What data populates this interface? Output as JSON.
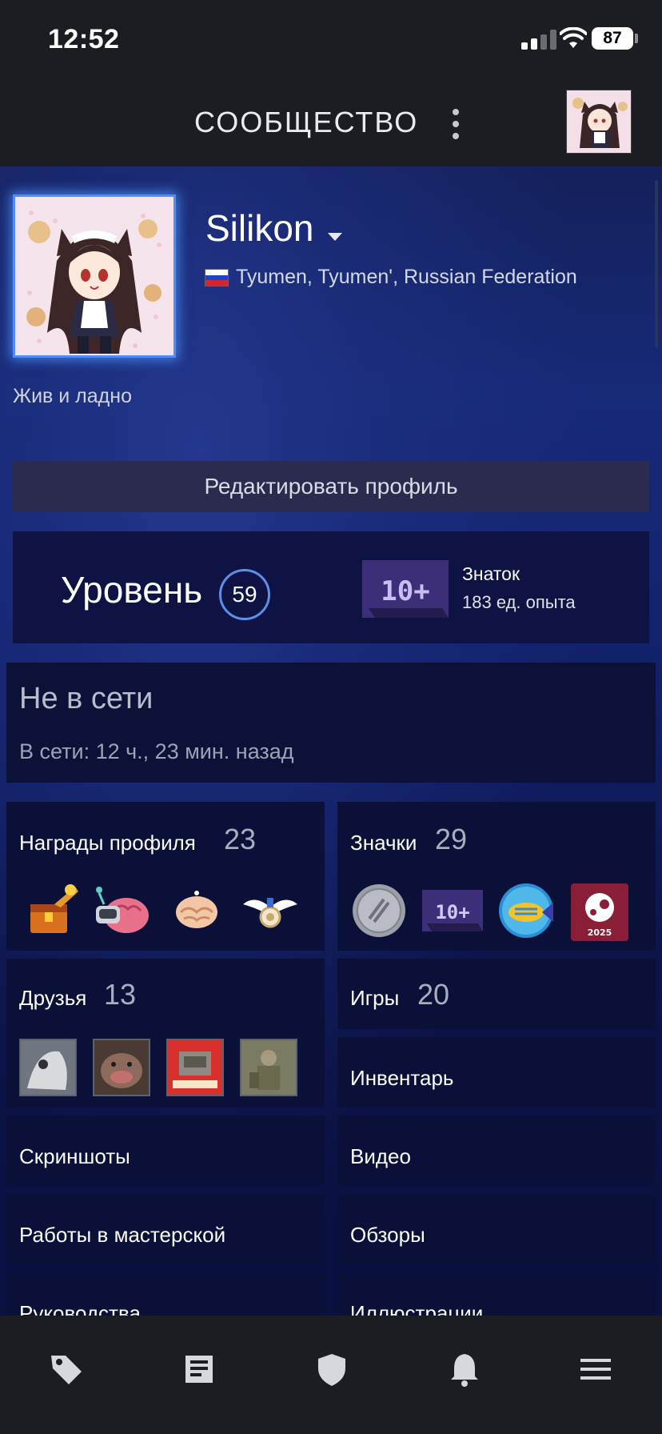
{
  "status_bar": {
    "time": "12:52",
    "battery": "87"
  },
  "header": {
    "title": "СООБЩЕСТВО",
    "menu_icon": "kebab-menu-icon",
    "avatar_icon": "user-avatar"
  },
  "profile": {
    "username": "Silikon",
    "location": "Tyumen, Tyumen', Russian Federation",
    "summary": "Жив и ладно",
    "edit_button": "Редактировать профиль"
  },
  "level": {
    "label": "Уровень",
    "value": "59",
    "xp_badge_text": "10+",
    "xp_title": "Знаток",
    "xp_value": "183 ед. опыта"
  },
  "online_status": {
    "state": "Не в сети",
    "last_online": "В сети: 12 ч., 23 мин. назад"
  },
  "tiles": {
    "awards": {
      "label": "Награды профиля",
      "count": "23"
    },
    "badges": {
      "label": "Значки",
      "count": "29",
      "badge_10_text": "10+",
      "badge_2025_text": "2025"
    },
    "friends": {
      "label": "Друзья",
      "count": "13"
    },
    "games": {
      "label": "Игры",
      "count": "20"
    },
    "inventory": {
      "label": "Инвентарь"
    },
    "screenshots": {
      "label": "Скриншоты"
    },
    "videos": {
      "label": "Видео"
    },
    "workshop": {
      "label": "Работы в мастерской"
    },
    "reviews": {
      "label": "Обзоры"
    },
    "guides": {
      "label": "Руководства"
    },
    "artwork": {
      "label": "Иллюстрации"
    }
  },
  "bottom_nav": {
    "items": [
      "store-tag-icon",
      "news-icon",
      "shield-icon",
      "notifications-bell-icon",
      "hamburger-menu-icon"
    ]
  },
  "colors": {
    "accent_blue": "#4f8cff",
    "panel_bg": "#0b1038",
    "edit_button_bg": "#2b2b50"
  }
}
